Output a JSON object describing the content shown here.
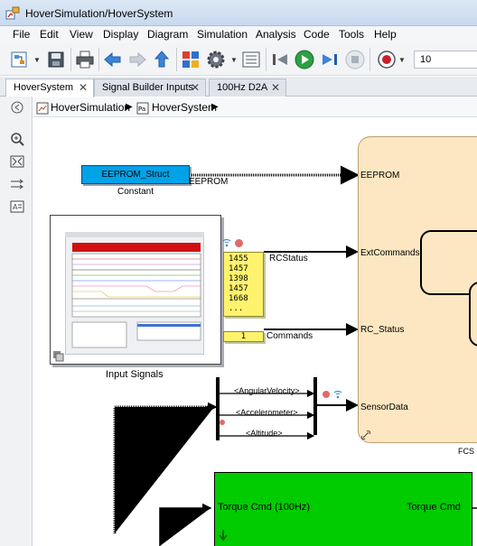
{
  "window": {
    "title": "HoverSimulation/HoverSystem"
  },
  "menu": [
    "File",
    "Edit",
    "View",
    "Display",
    "Diagram",
    "Simulation",
    "Analysis",
    "Code",
    "Tools",
    "Help"
  ],
  "toolbar": {
    "icons": [
      "library-browser-icon",
      "save-icon",
      "print-icon",
      "back-icon",
      "forward-icon",
      "up-icon",
      "model-explorer-icon",
      "settings-gear-icon",
      "model-config-icon",
      "step-back-icon",
      "run-icon",
      "step-forward-icon",
      "stop-icon",
      "record-icon"
    ],
    "stop_time": "10"
  },
  "tabs": [
    {
      "label": "HoverSystem",
      "active": true,
      "close": "✕"
    },
    {
      "label": "Signal Builder Inputs",
      "active": false,
      "close": "✕"
    },
    {
      "label": "100Hz D2A",
      "active": false,
      "close": "✕"
    }
  ],
  "breadcrumb": {
    "root": "HoverSimulation",
    "current": "HoverSystem"
  },
  "diagram": {
    "constant_block": {
      "value": "EEPROM_Struct",
      "caption": "Constant",
      "signal": "EEPROM"
    },
    "input_signals": {
      "caption": "Input Signals"
    },
    "rc_display": {
      "values": [
        "1455",
        "1457",
        "1398",
        "1457",
        "1668",
        "..."
      ],
      "signal": "RCStatus"
    },
    "commands_display": {
      "value": "1",
      "signal": "Commands"
    },
    "bus": {
      "signals": [
        "<AngularVelocity>",
        "<Accelerometer>",
        "<Altitude>"
      ]
    },
    "fcs_block": {
      "ports": [
        "EEPROM",
        "ExtCommands",
        "RC_Status",
        "SensorData"
      ],
      "caption": "FCS M"
    },
    "green_block": {
      "input_label": "Torque Cmd (100Hz)",
      "output_label": "Torque Cmd",
      "color": "#00cc00"
    }
  }
}
